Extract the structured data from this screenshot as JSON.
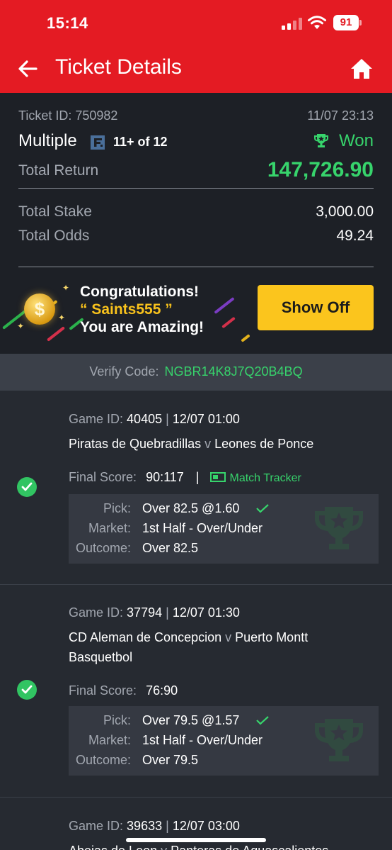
{
  "status_bar": {
    "time": "15:14",
    "battery": "91"
  },
  "header": {
    "title": "Ticket Details"
  },
  "ticket": {
    "id_label": "Ticket ID: 750982",
    "date": "11/07 23:13",
    "type": "Multiple",
    "count": "11+ of 12",
    "status": "Won",
    "return_label": "Total Return",
    "return_value": "147,726.90",
    "stake_label": "Total Stake",
    "stake_value": "3,000.00",
    "odds_label": "Total Odds",
    "odds_value": "49.24"
  },
  "congrats": {
    "line1": "Congratulations!",
    "line2": "“ Saints555 ”",
    "line3": "You are Amazing!",
    "button": "Show Off",
    "coin_symbol": "$"
  },
  "verify": {
    "label": "Verify Code:",
    "code": "NGBR14K8J7Q20B4BQ"
  },
  "games": [
    {
      "game_id_label": "Game ID:",
      "game_id": "40405",
      "sep": "|",
      "time": "12/07 01:00",
      "home": "Piratas de Quebradillas",
      "vs": "v",
      "away": "Leones de Ponce",
      "score_label": "Final Score:",
      "score": "90:117",
      "score_sep": "|",
      "tracker": "Match Tracker",
      "pick_label": "Pick:",
      "pick": "Over 82.5 @1.60",
      "market_label": "Market:",
      "market": "1st Half - Over/Under",
      "outcome_label": "Outcome:",
      "outcome": "Over 82.5"
    },
    {
      "game_id_label": "Game ID:",
      "game_id": "37794",
      "sep": "|",
      "time": "12/07 01:30",
      "home": "CD Aleman de Concepcion",
      "vs": "v",
      "away": "Puerto Montt Basquetbol",
      "score_label": "Final Score:",
      "score": "76:90",
      "pick_label": "Pick:",
      "pick": "Over 79.5 @1.57",
      "market_label": "Market:",
      "market": "1st Half - Over/Under",
      "outcome_label": "Outcome:",
      "outcome": "Over 79.5"
    },
    {
      "game_id_label": "Game ID:",
      "game_id": "39633",
      "sep": "|",
      "time": "12/07 03:00",
      "home": "Abejas de Leon",
      "vs": "v",
      "away": "Panteras de Aguascalientes"
    }
  ],
  "colors": {
    "brand_red": "#e41b23",
    "win_green": "#37d46c",
    "accent_yellow": "#fbc51d"
  }
}
